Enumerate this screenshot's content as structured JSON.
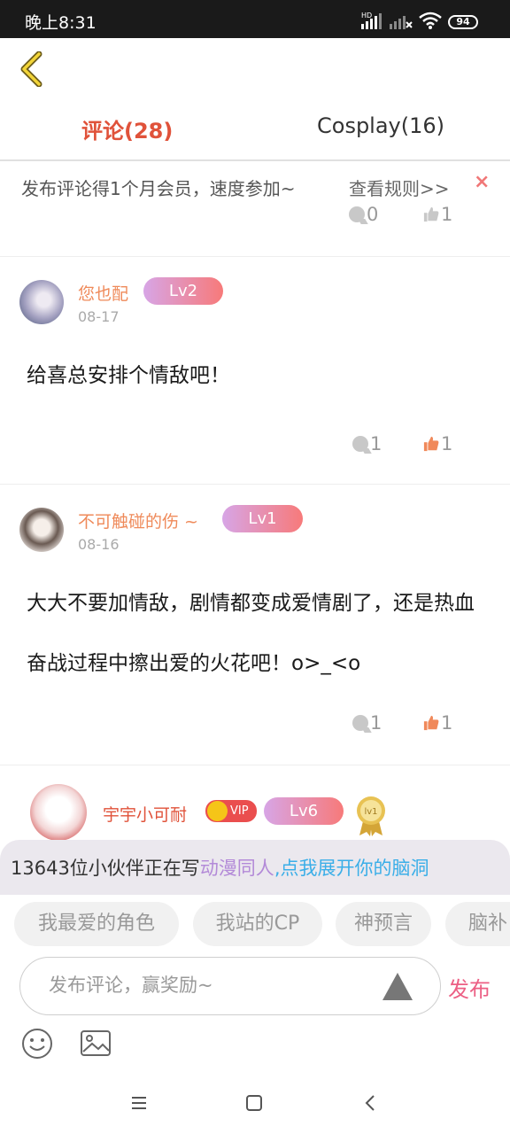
{
  "status_bar": {
    "time": "晚上8:31",
    "battery": "94",
    "hd_label": "HD"
  },
  "tabs": [
    {
      "label": "评论(28)",
      "active": true
    },
    {
      "label": "Cosplay(16)",
      "active": false
    }
  ],
  "notice": {
    "text": "发布评论得1个月会员，速度参加~",
    "rules_link": "查看规则>>",
    "close": "×",
    "comments": "0",
    "likes": "1"
  },
  "comments": [
    {
      "username": "您也配",
      "level": "Lv2",
      "date": "08-17",
      "content": "给喜总安排个情敌吧！",
      "comment_count": "1",
      "like_count": "1"
    },
    {
      "username": "不可触碰的伤 ~",
      "level": "Lv1",
      "date": "08-16",
      "content": "大大不要加情敌，剧情都变成爱情剧了，还是热血奋战过程中擦出爱的火花吧！o>_<o",
      "comment_count": "1",
      "like_count": "1"
    },
    {
      "username": "宇宇小可耐",
      "vip": "VIP",
      "level": "Lv6",
      "medal": "lv1"
    }
  ],
  "prompt": {
    "part1": "13643位小伙伴正在写",
    "part2": "动漫同人",
    "part3": ",点我展开你的脑洞"
  },
  "chips": [
    "我最爱的角色",
    "我站的CP",
    "神预言",
    "脑补"
  ],
  "input": {
    "placeholder": "发布评论，赢奖励~",
    "send_label": "发布"
  },
  "colors": {
    "accent": "#e0523a",
    "username": "#ef8a5a",
    "send": "#ec5f84",
    "like": "#f0895a",
    "level_gradient_start": "#d7a5e6",
    "level_gradient_end": "#f77a7a"
  },
  "icons": [
    "back-icon",
    "comment-icon",
    "like-icon",
    "emoji-icon",
    "image-icon",
    "menu-icon",
    "home-icon",
    "nav-back-icon"
  ]
}
